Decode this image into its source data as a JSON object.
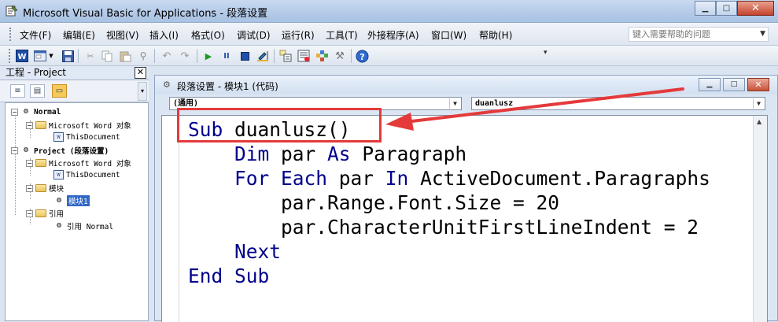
{
  "window": {
    "title": "Microsoft Visual Basic for Applications - 段落设置",
    "min_glyph": "▁",
    "max_glyph": "□",
    "close_glyph": "✕"
  },
  "menu": {
    "items": [
      "文件(F)",
      "编辑(E)",
      "视图(V)",
      "插入(I)",
      "格式(O)",
      "调试(D)",
      "运行(R)",
      "工具(T)",
      "外接程序(A)",
      "窗口(W)",
      "帮助(H)"
    ],
    "help_placeholder": "键入需要帮助的问题"
  },
  "toolbar": {
    "icons": [
      "word-icon",
      "insert-userform-icon",
      "save-icon",
      "cut-icon",
      "copy-icon",
      "paste-icon",
      "find-icon",
      "undo-icon",
      "redo-icon",
      "run-icon",
      "break-icon",
      "reset-icon",
      "design-mode-icon",
      "project-explorer-icon",
      "properties-icon",
      "object-browser-icon",
      "toolbox-icon",
      "help-icon"
    ]
  },
  "project": {
    "title": "工程 - Project",
    "close_glyph": "✕",
    "tree": [
      {
        "label": "Normal",
        "bold": true
      },
      {
        "label": "Microsoft Word 对象"
      },
      {
        "label": "ThisDocument"
      },
      {
        "label": "Project (段落设置)",
        "bold": true
      },
      {
        "label": "Microsoft Word 对象"
      },
      {
        "label": "ThisDocument"
      },
      {
        "label": "模块"
      },
      {
        "label": "模块1",
        "selected": true
      },
      {
        "label": "引用"
      },
      {
        "label": "引用 Normal"
      }
    ]
  },
  "code_window": {
    "title": "段落设置 - 模块1 (代码)",
    "object_combo": "(通用)",
    "proc_combo": "duanlusz",
    "lines": [
      {
        "kw1": "Sub",
        "text": " duanlusz()"
      },
      {
        "indent": "    ",
        "kw1": "Dim",
        "text": " par ",
        "kw2": "As",
        "text2": " Paragraph"
      },
      {
        "indent": "    ",
        "kw1": "For Each",
        "text": " par ",
        "kw2": "In",
        "text2": " ActiveDocument.Paragraphs"
      },
      {
        "indent": "        ",
        "text": "par.Range.Font.Size = 20"
      },
      {
        "indent": "        ",
        "text": "par.CharacterUnitFirstLineIndent = 2"
      },
      {
        "indent": "    ",
        "kw1": "Next",
        "text": ""
      },
      {
        "kw1": "End Sub",
        "text": ""
      }
    ]
  },
  "colors": {
    "keyword": "#00008b",
    "annotation": "#e43a3a",
    "selection": "#3168c6"
  }
}
